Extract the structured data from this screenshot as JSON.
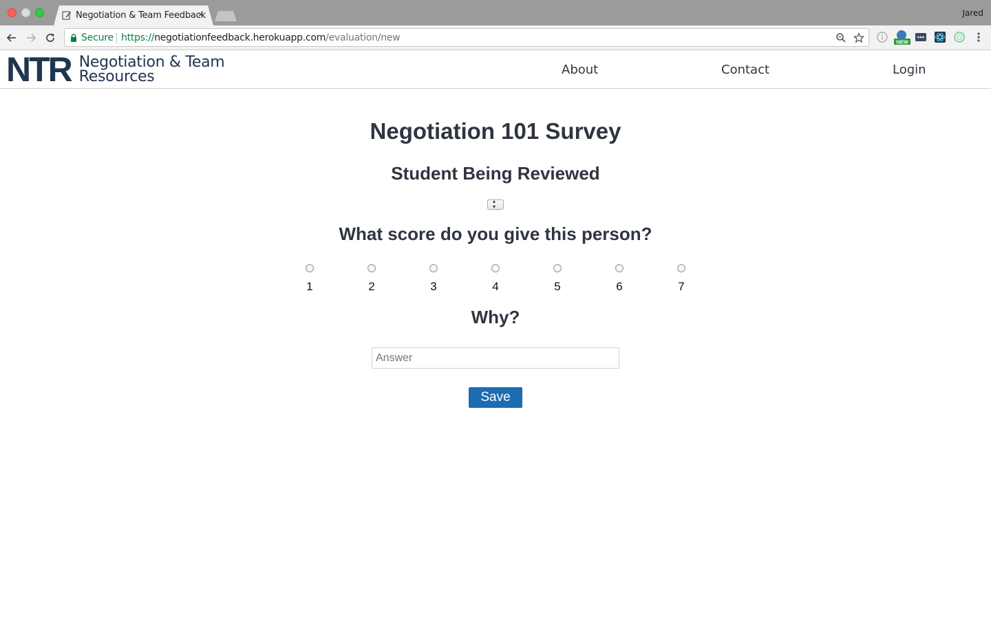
{
  "browser": {
    "tab_title": "Negotiation & Team Feedback",
    "tab_close": "×",
    "profile_name": "Jared",
    "secure_label": "Secure",
    "url_scheme": "https://",
    "url_host": "negotiationfeedback.herokuapp.com",
    "url_path": "/evaluation/new"
  },
  "site": {
    "logo_mark": "NTR",
    "logo_line1": "Negotiation & Team",
    "logo_line2": "Resources",
    "nav": {
      "about": "About",
      "contact": "Contact",
      "login": "Login"
    }
  },
  "survey": {
    "title": "Negotiation 101 Survey",
    "student_label": "Student Being Reviewed",
    "student_selected": "",
    "score_question": "What score do you give this person?",
    "score_options": [
      "1",
      "2",
      "3",
      "4",
      "5",
      "6",
      "7"
    ],
    "why_label": "Why?",
    "answer_placeholder": "Answer",
    "answer_value": "",
    "save_label": "Save"
  },
  "colors": {
    "accent": "#1d6bb0",
    "brand": "#1f3550",
    "secure_green": "#0b8043"
  }
}
